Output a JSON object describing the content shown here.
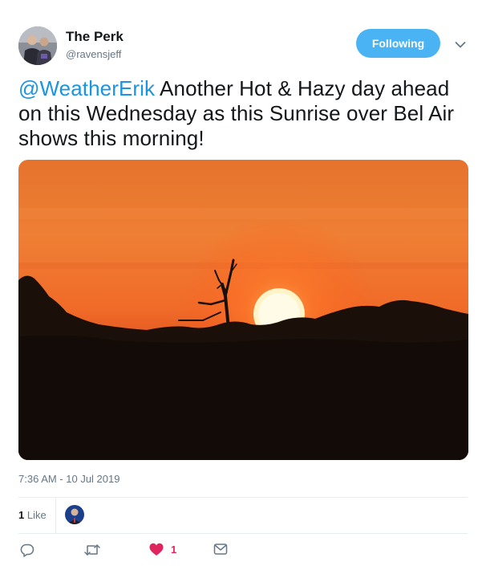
{
  "author": {
    "display_name": "The Perk",
    "handle": "@ravensjeff",
    "avatar_icon": "profile-photo"
  },
  "follow_button": {
    "label": "Following",
    "color": "#4ab3f4"
  },
  "tweet": {
    "mention": "@WeatherErik",
    "text": " Another Hot & Hazy day ahead on this Wednesday as this Sunrise over Bel Air shows this morning!",
    "mention_color": "#1b95e0"
  },
  "timestamp": "7:36 AM - 10 Jul 2019",
  "stats": {
    "likes_count": "1",
    "likes_label": " Like"
  },
  "actions": {
    "reply_icon": "reply-icon",
    "retweet_icon": "retweet-icon",
    "like_icon": "heart-icon",
    "like_count": "1",
    "like_color": "#e0245e",
    "dm_icon": "envelope-icon"
  }
}
